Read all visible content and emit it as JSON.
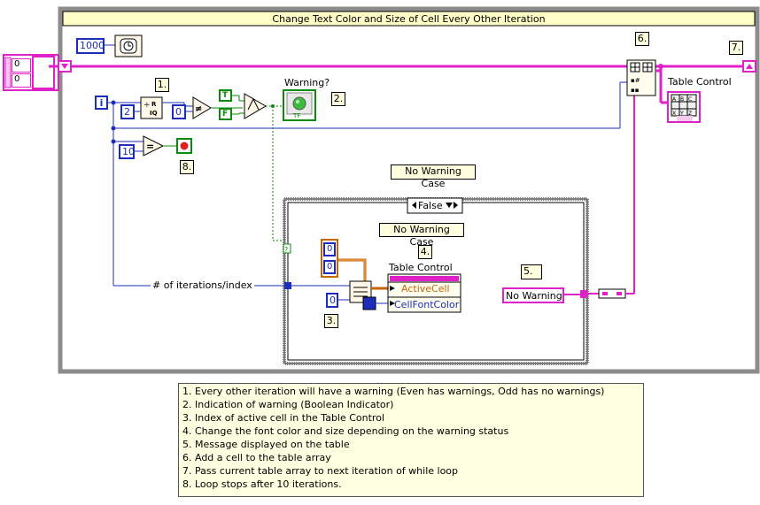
{
  "loop": {
    "title": "Change Text Color and Size of Cell Every Other Iteration",
    "wait_ms": "1000",
    "iteration_terminal": "i"
  },
  "left_array": {
    "values": [
      "0",
      "0"
    ]
  },
  "constants": {
    "divisor": "2",
    "zero_compare": "0",
    "stop_count": "10",
    "active_cell_row": "0",
    "active_cell_col": "0",
    "index_const": "0",
    "true_const": "T",
    "false_const": "F"
  },
  "indicator": {
    "label": "Warning?",
    "tf_text": "TF"
  },
  "labels": {
    "no_warning_case_outer": "No Warning Case",
    "no_warning_case_inner": "No Warning Case",
    "iterations_index": "# of iterations/index",
    "table_control_property": "Table Control",
    "prop_active_cell": "ActiveCell",
    "prop_cell_font_color": "CellFontColor",
    "table_control_terminal": "Table Control",
    "no_warning_string": "No Warning"
  },
  "case_selector": {
    "value": "False"
  },
  "tags": {
    "t1": "1.",
    "t2": "2.",
    "t3": "3.",
    "t4": "4.",
    "t5": "5.",
    "t6": "6.",
    "t7": "7.",
    "t8": "8."
  },
  "notes": [
    "1. Every other iteration will have a warning (Even has warnings, Odd has no warnings)",
    "2. Indication of warning (Boolean Indicator)",
    "3. Index of active cell in the Table Control",
    "4. Change the font color and size depending on the warning status",
    "5. Message displayed on the table",
    "6. Add a cell to the table array",
    "7. Pass current table array to next iteration of while loop",
    "8. Loop stops after 10 iterations."
  ],
  "colors": {
    "loop_border": "#8c8c8c",
    "title_bar": "#ffffc8",
    "string_wire": "#e020c8",
    "numeric_wire": "#1c2dbb",
    "boolean_wire": "#0a8a0a",
    "orange_wire": "#c86400",
    "note_bg": "#ffffe1"
  }
}
